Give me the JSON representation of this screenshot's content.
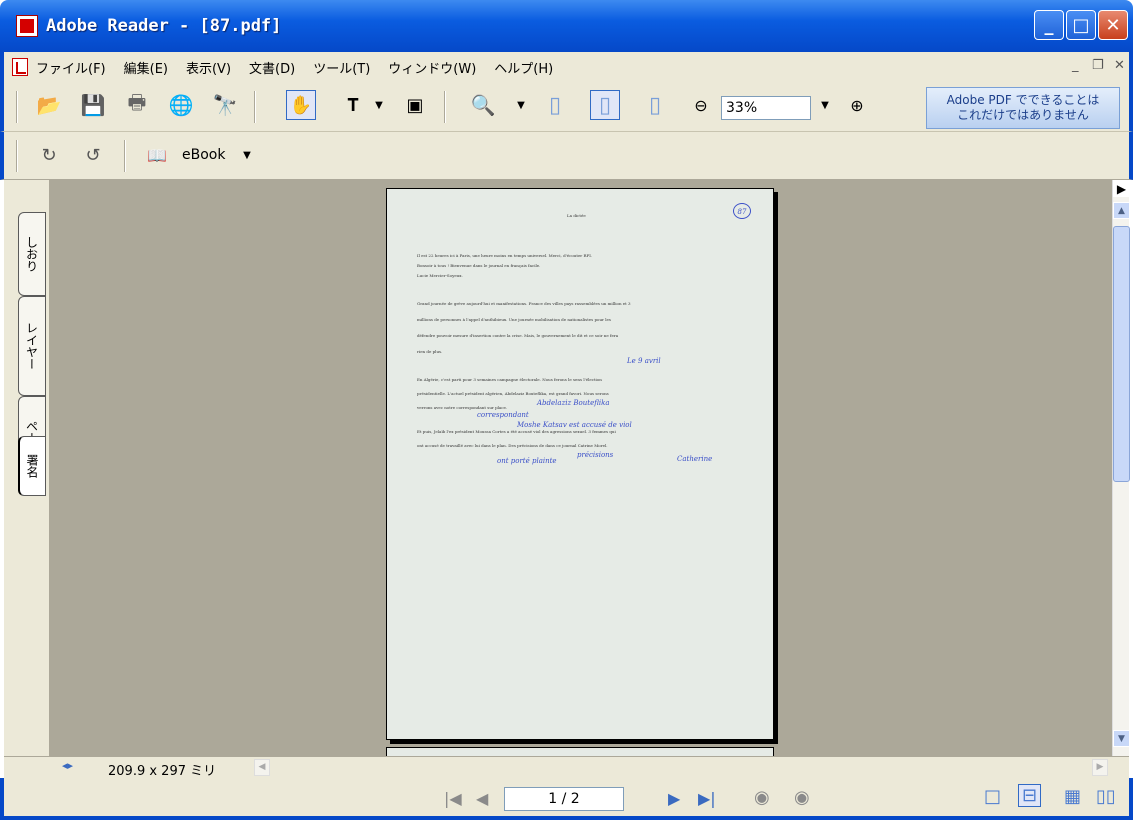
{
  "window": {
    "title": "Adobe Reader - [87.pdf]"
  },
  "menu": [
    "ファイル(F)",
    "編集(E)",
    "表示(V)",
    "文書(D)",
    "ツール(T)",
    "ウィンドウ(W)",
    "ヘルプ(H)"
  ],
  "toolbar": {
    "zoom": "33%",
    "ebook": "eBook"
  },
  "promo": {
    "line1": "Adobe PDF でできることは",
    "line2": "これだけではありません"
  },
  "nav_tabs": [
    "しおり",
    "レイヤー",
    "ページ",
    "署名"
  ],
  "status": {
    "page_size": "209.9 x 297 ミリ",
    "page_counter": "1 / 2"
  },
  "document": {
    "title": "La dictée",
    "page_number": "87",
    "lines": [
      "Il est 22 heures ici à Paris, une heure moins en temps universel. Merci, d'écouter RFI.",
      "Bonsoir à tous ! Bienvenue dans le journal en français facile.",
      "Lucie Mercier-Soyeux.",
      "Grand journée de grève aujourd'hui et manifestations. France des villes pays rassemblées un million et 3",
      "millions de personnes à l'appel d'anthibieux. Une journée mobilisation de nationalistes pour les",
      "défendre pouvoir mesure d'insertion contre la crise. Mais, le gouvernement le dit et ce soir ne fera",
      "rien de plus.",
      "En Algérie, c'est parti pour 3 semaines campagne électorale. Nous ferons le sens l'élection",
      "présidentielle. L'actuel président algérien, Abdelaziz Bouteflika, est grand favori. Nous serons",
      "verrons avec notre correspondant sur place.",
      "Et puis, Jelaïb l'ex président Moussa Cortes a été accusé viol des agressions sexuel. 3 femmes qui",
      "ont accusé de travaillé avec lui dans le plan. Des précisions de dans ce journal Catrine Morel."
    ],
    "annotations": [
      "Le 9 avril",
      "Abdelaziz Bouteflika",
      "Moshe Katsav est accusé de viol",
      "correspondant",
      "précisions",
      "Catherine",
      "ont porté plainte"
    ]
  }
}
